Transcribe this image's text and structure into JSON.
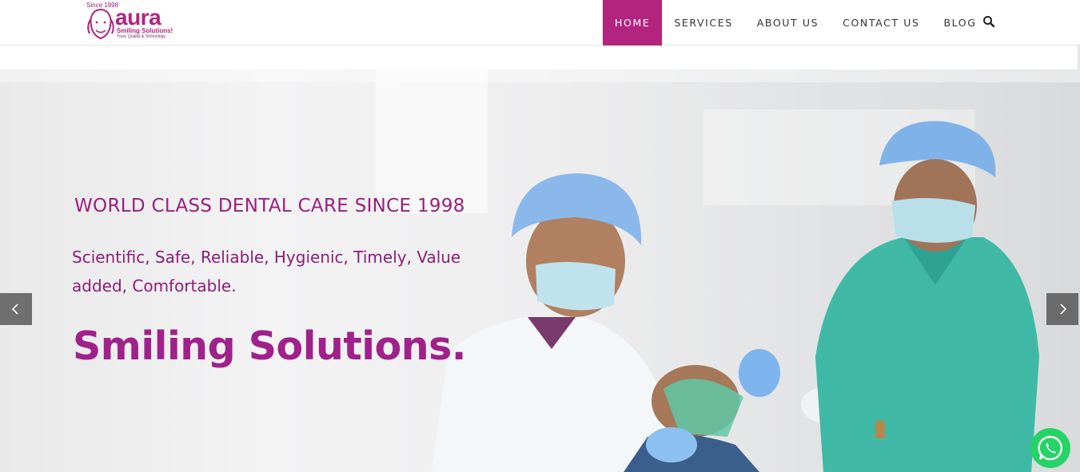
{
  "logo": {
    "since": "Since 1998",
    "wordmark": "aura",
    "tagline": "Smiling Solutions!",
    "subtagline": "Trust, Quality & Technology"
  },
  "nav": {
    "items": [
      {
        "label": "HOME",
        "active": true
      },
      {
        "label": "SERVICES",
        "active": false
      },
      {
        "label": "ABOUT US",
        "active": false
      },
      {
        "label": "CONTACT US",
        "active": false
      },
      {
        "label": "BLOG",
        "active": false
      }
    ],
    "search_icon": "search-icon"
  },
  "hero": {
    "kicker": "WORLD CLASS DENTAL CARE SINCE 1998",
    "subtitle": "Scientific, Safe, Reliable, Hygienic, Timely, Value added, Comfortable.",
    "headline": "Smiling Solutions.",
    "prev_icon": "chevron-left-icon",
    "next_icon": "chevron-right-icon"
  },
  "whatsapp": {
    "icon": "whatsapp-icon"
  },
  "colors": {
    "brand": "#b3247f",
    "hero_text": "#9c1f7f",
    "scrub_teal": "#3fb9a5",
    "cap_blue": "#6fa9e0",
    "whatsapp": "#25d366"
  }
}
